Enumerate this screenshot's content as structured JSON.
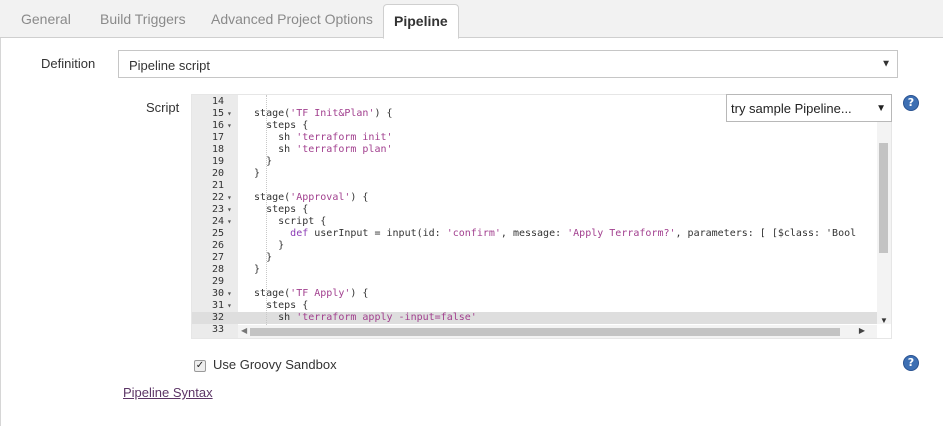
{
  "tabs": [
    {
      "label": "General"
    },
    {
      "label": "Build Triggers"
    },
    {
      "label": "Advanced Project Options"
    },
    {
      "label": "Pipeline",
      "active": true
    }
  ],
  "definition": {
    "label": "Definition",
    "value": "Pipeline script"
  },
  "script": {
    "label": "Script",
    "sample_select": "try sample Pipeline...",
    "lines": [
      {
        "n": "14",
        "fold": false,
        "text": ""
      },
      {
        "n": "15",
        "fold": true,
        "text": "  stage('TF Init&Plan') {"
      },
      {
        "n": "16",
        "fold": true,
        "text": "    steps {"
      },
      {
        "n": "17",
        "fold": false,
        "text": "      sh 'terraform init'"
      },
      {
        "n": "18",
        "fold": false,
        "text": "      sh 'terraform plan'"
      },
      {
        "n": "19",
        "fold": false,
        "text": "    }"
      },
      {
        "n": "20",
        "fold": false,
        "text": "  }"
      },
      {
        "n": "21",
        "fold": false,
        "text": ""
      },
      {
        "n": "22",
        "fold": true,
        "text": "  stage('Approval') {"
      },
      {
        "n": "23",
        "fold": true,
        "text": "    steps {"
      },
      {
        "n": "24",
        "fold": true,
        "text": "      script {"
      },
      {
        "n": "25",
        "fold": false,
        "text": "        def userInput = input(id: 'confirm', message: 'Apply Terraform?', parameters: [ [$class: 'Bool"
      },
      {
        "n": "26",
        "fold": false,
        "text": "      }"
      },
      {
        "n": "27",
        "fold": false,
        "text": "    }"
      },
      {
        "n": "28",
        "fold": false,
        "text": "  }"
      },
      {
        "n": "29",
        "fold": false,
        "text": ""
      },
      {
        "n": "30",
        "fold": true,
        "text": "  stage('TF Apply') {"
      },
      {
        "n": "31",
        "fold": true,
        "text": "    steps {"
      },
      {
        "n": "32",
        "fold": false,
        "text": "      sh 'terraform apply -input=false'",
        "active": true
      },
      {
        "n": "33",
        "fold": false,
        "text": ""
      }
    ],
    "vertical_scroll_fraction": 0.45,
    "horizontal_scroll_fraction": 0.0
  },
  "sandbox": {
    "label": "Use Groovy Sandbox",
    "checked": true
  },
  "pipeline_syntax_link": "Pipeline Syntax",
  "icons": {
    "help": "question-circle-icon",
    "dropdown": "caret-down-icon",
    "fold": "fold-arrow-icon"
  },
  "colors": {
    "string": "#a2408f",
    "keyword": "#8b3bb5",
    "link": "#5c3566",
    "help": "#3d6fb3"
  }
}
